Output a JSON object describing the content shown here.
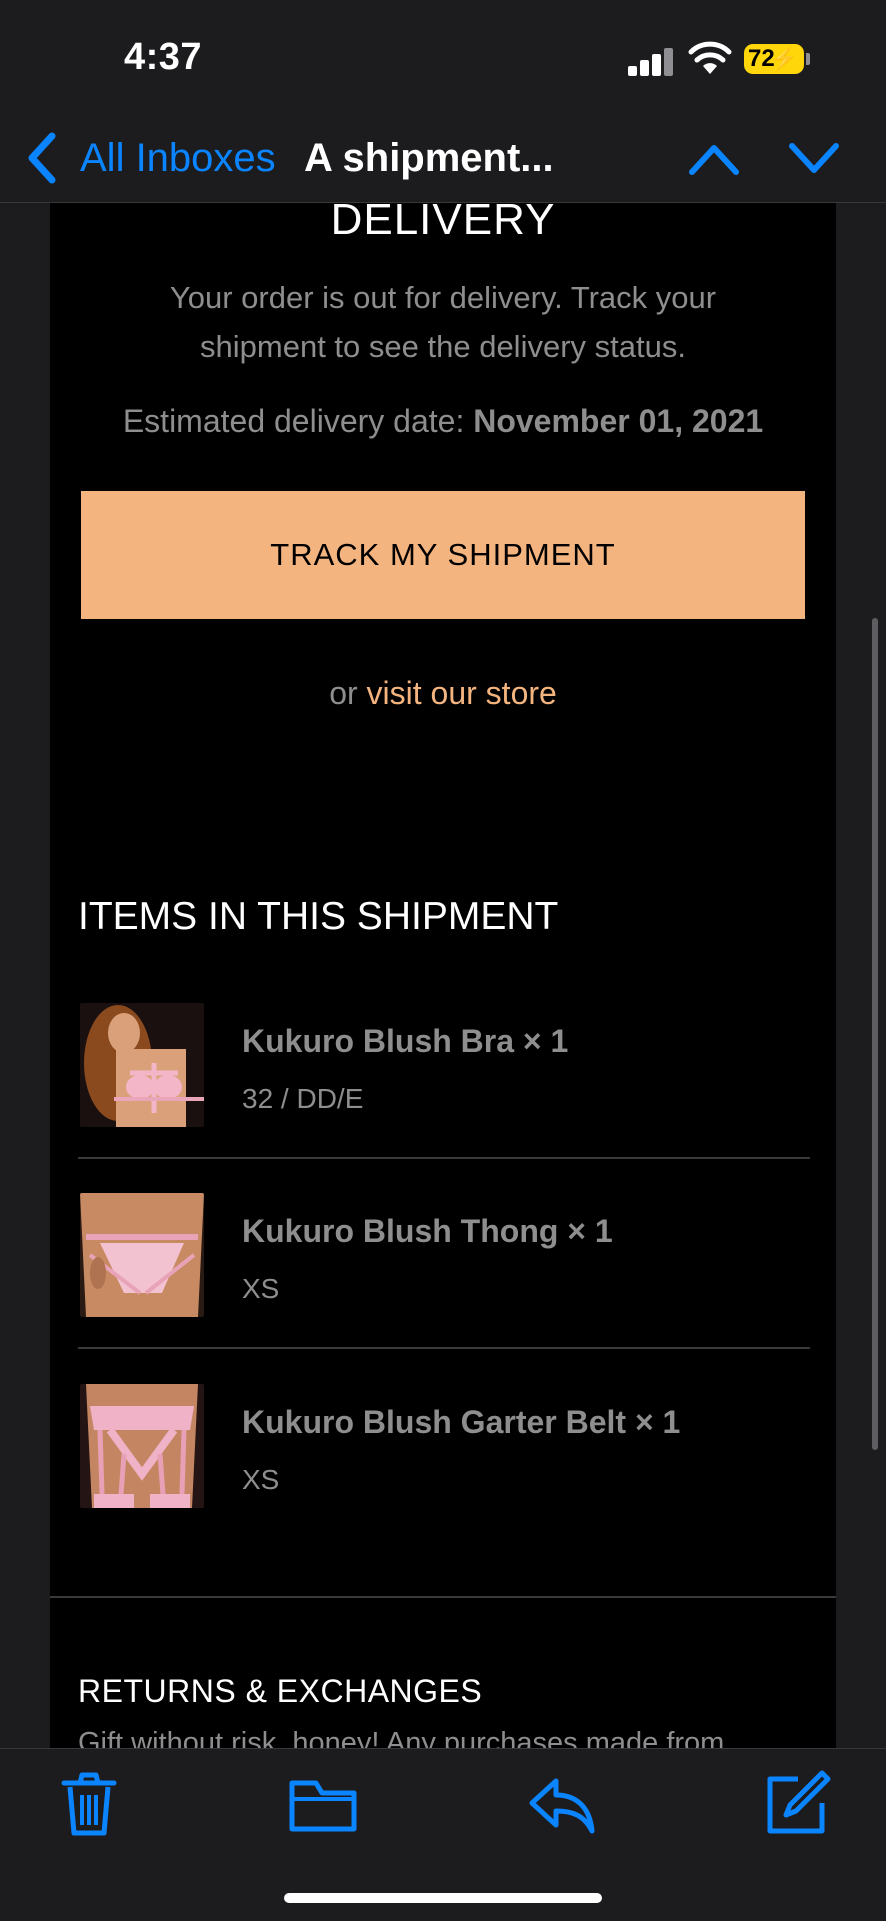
{
  "status_bar": {
    "time": "4:37",
    "battery": "72"
  },
  "nav": {
    "back_label": "All Inboxes",
    "title": "A shipment..."
  },
  "email": {
    "heading": "DELIVERY",
    "intro": "Your order is out for delivery. Track your shipment to see the delivery status.",
    "eta_label": "Estimated delivery date:",
    "eta_value": "November 01, 2021",
    "track_button": "TRACK MY SHIPMENT",
    "alt_prefix": "or",
    "alt_link": "visit our store",
    "items_title": "ITEMS IN THIS SHIPMENT",
    "items": [
      {
        "name": "Kukuro Blush Bra × 1",
        "variant": "32 / DD/E"
      },
      {
        "name": "Kukuro Blush Thong × 1",
        "variant": "XS"
      },
      {
        "name": "Kukuro Blush Garter Belt × 1",
        "variant": "XS"
      }
    ],
    "returns_title": "RETURNS & EXCHANGES",
    "returns_text": "Gift without risk, honey! Any purchases made from"
  },
  "colors": {
    "accent": "#0a84ff",
    "button": "#f4b47f",
    "battery": "#ffd60a"
  },
  "toolbar": {
    "icons": [
      "trash-icon",
      "folder-icon",
      "reply-icon",
      "compose-icon"
    ]
  }
}
